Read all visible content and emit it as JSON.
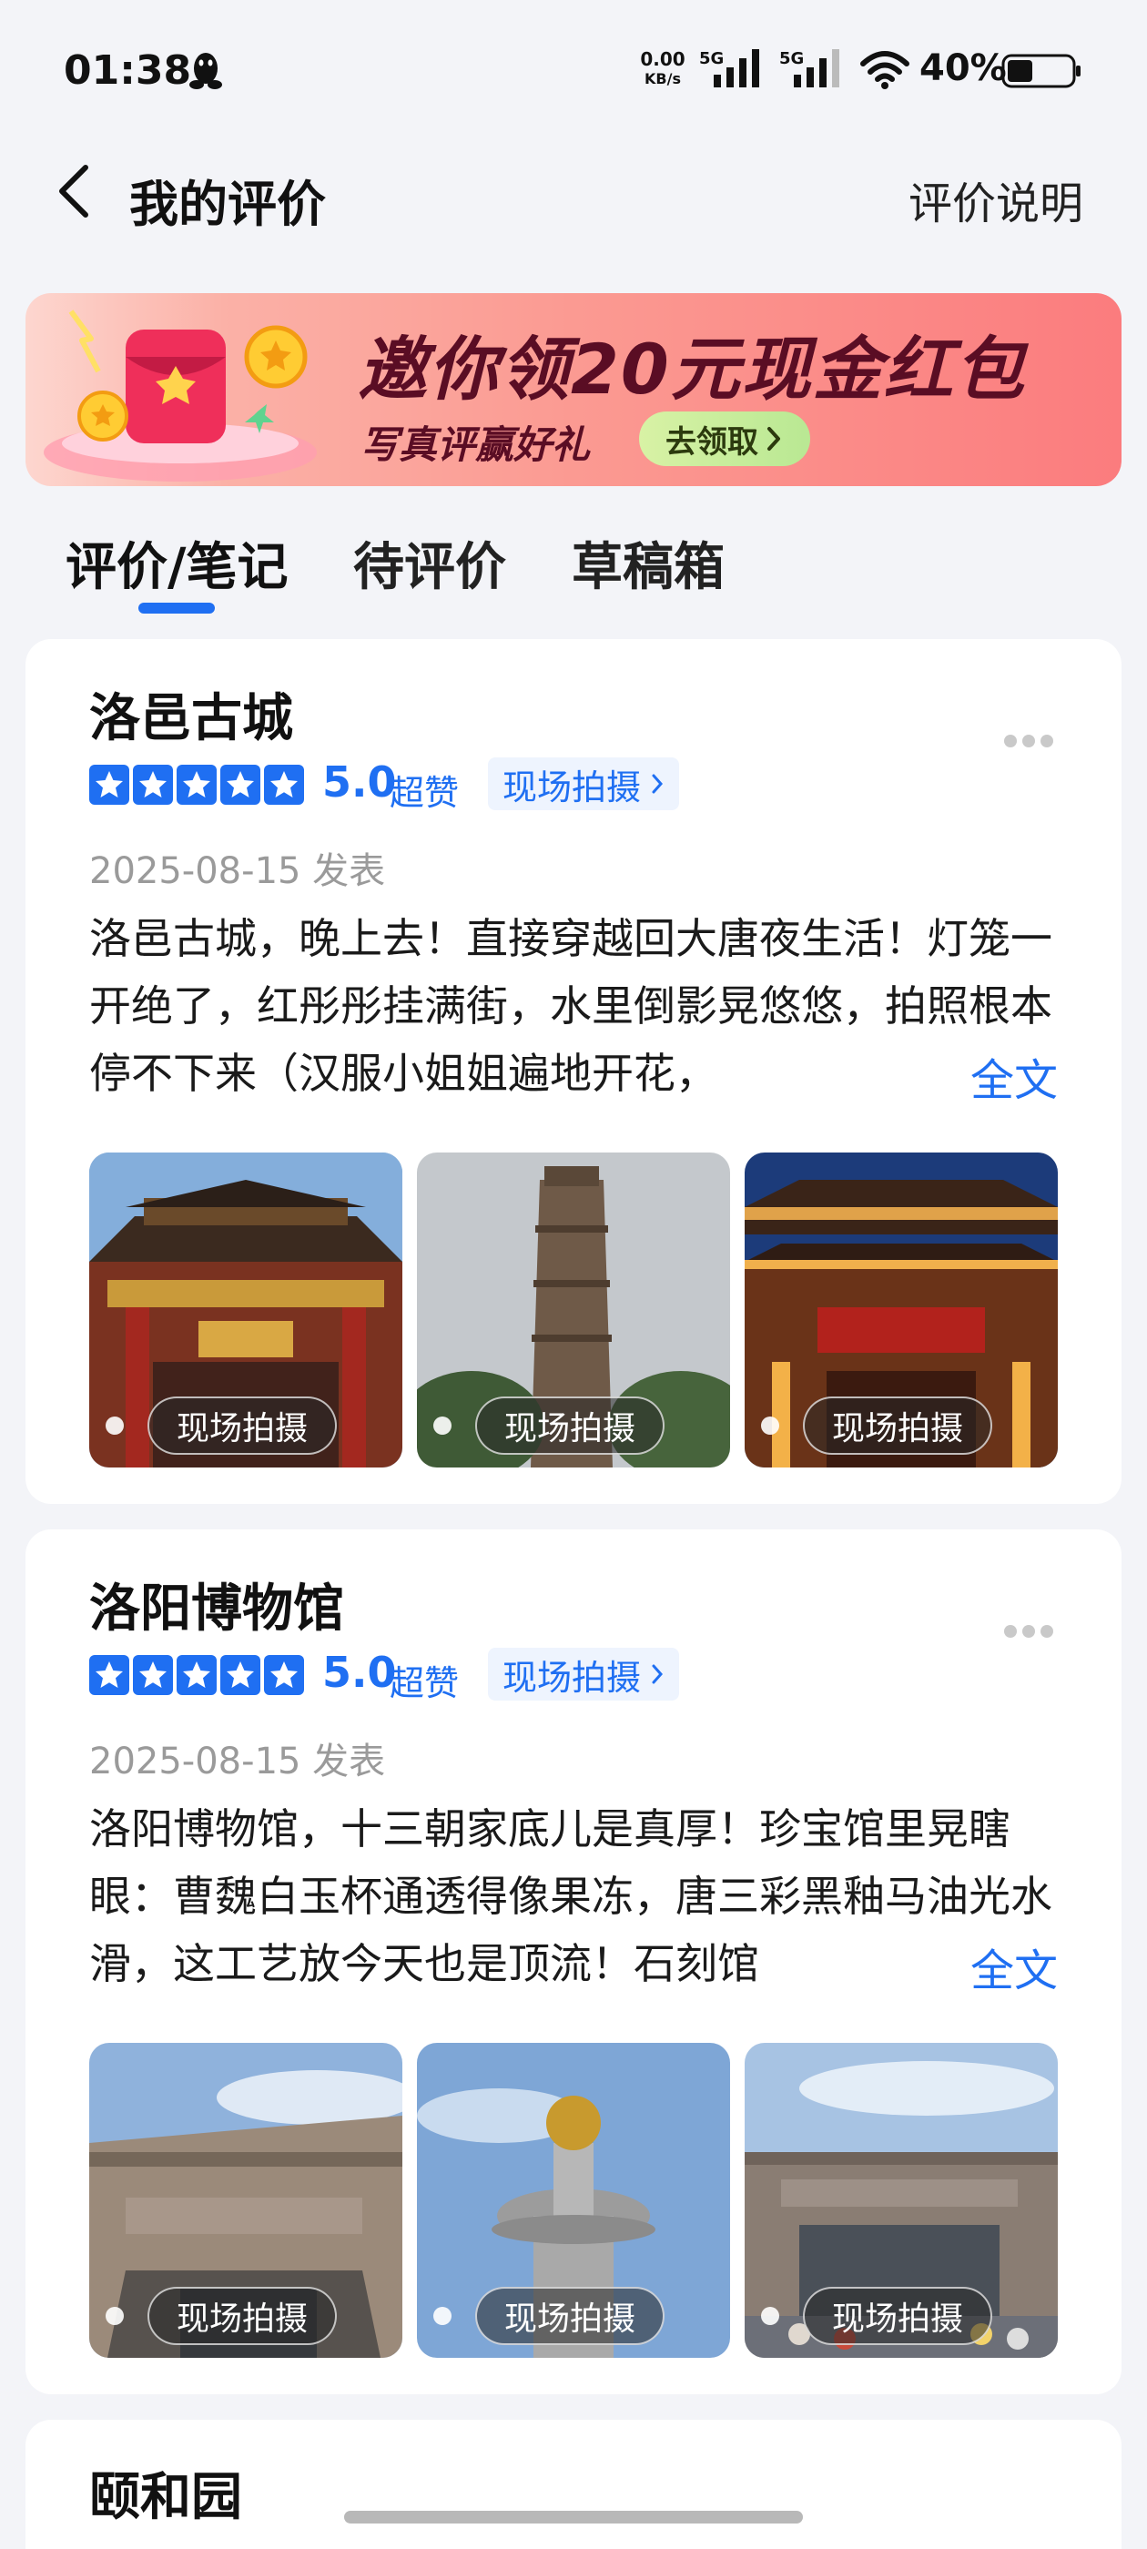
{
  "status_bar": {
    "time": "01:38",
    "net_speed_value": "0.00",
    "net_speed_unit": "KB/s",
    "signal_1_label": "5G",
    "signal_2_label": "5G",
    "battery": "40%",
    "battery_level": 0.4
  },
  "nav": {
    "title": "我的评价",
    "help_link": "评价说明",
    "back_icon": "chevron-left-icon"
  },
  "banner": {
    "title": "邀你领20元现金红包",
    "subtitle": "写真评赢好礼",
    "button": "去领取"
  },
  "tabs": [
    {
      "label": "评价/笔记",
      "active": true
    },
    {
      "label": "待评价",
      "active": false
    },
    {
      "label": "草稿箱",
      "active": false
    }
  ],
  "reviews": [
    {
      "place": "洛邑古城",
      "rating": 5,
      "score": "5.0",
      "score_word": "超赞",
      "tag": "现场拍摄",
      "date": "2025-08-15 发表",
      "text": "洛邑古城，晚上去！直接穿越回大唐夜生活！灯笼一开绝了，红彤彤挂满街，水里倒影晃悠悠，拍照根本停不下来（汉服小姐姐遍地开花，",
      "full_link": "全文",
      "photo_badges": [
        "现场拍摄",
        "现场拍摄",
        "现场拍摄"
      ]
    },
    {
      "place": "洛阳博物馆",
      "rating": 5,
      "score": "5.0",
      "score_word": "超赞",
      "tag": "现场拍摄",
      "date": "2025-08-15 发表",
      "text": "洛阳博物馆，十三朝家底儿是真厚！珍宝馆里晃瞎眼：曹魏白玉杯通透得像果冻，唐三彩黑釉马油光水滑，这工艺放今天也是顶流！石刻馆",
      "full_link": "全文",
      "photo_badges": [
        "现场拍摄",
        "现场拍摄",
        "现场拍摄"
      ]
    },
    {
      "place": "颐和园"
    }
  ],
  "colors": {
    "accent": "#1f6ff2",
    "background": "#f3f4f8",
    "banner_text": "#5a0d24"
  }
}
